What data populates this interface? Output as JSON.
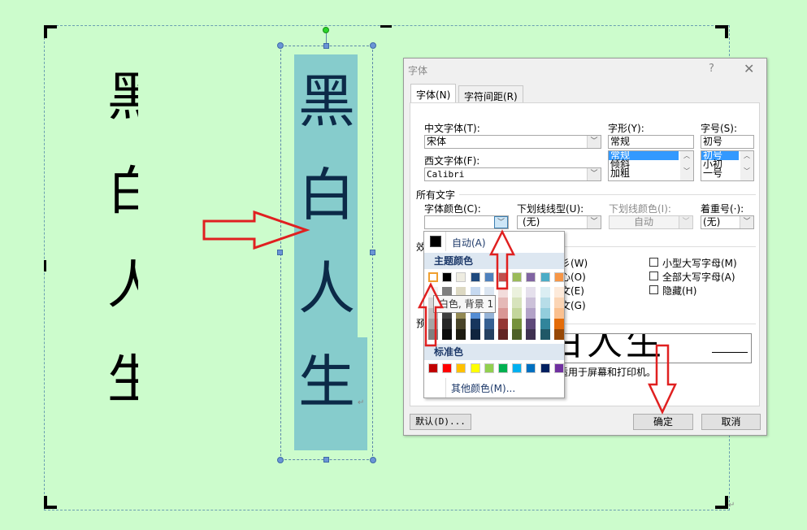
{
  "document": {
    "left_column_chars": [
      "黑",
      "白",
      "人",
      "生"
    ],
    "textbox_chars": [
      "黑",
      "白",
      "人",
      "生"
    ],
    "paragraph_mark": "↵"
  },
  "dialog": {
    "title": "字体",
    "help": "?",
    "close": "✕",
    "tabs": [
      {
        "label": "字体(N)",
        "active": true
      },
      {
        "label": "字符间距(R)",
        "active": false
      }
    ],
    "chinese_font": {
      "label": "中文字体(T):",
      "value": "宋体"
    },
    "western_font": {
      "label": "西文字体(F):",
      "value": "Calibri"
    },
    "style": {
      "label": "字形(Y):",
      "value": "常规",
      "options": [
        "常规",
        "倾斜",
        "加粗"
      ],
      "selected": "常规"
    },
    "size": {
      "label": "字号(S):",
      "value": "初号",
      "options": [
        "初号",
        "小初",
        "一号"
      ],
      "selected": "初号"
    },
    "all_text_section": "所有文字",
    "font_color": {
      "label": "字体颜色(C):",
      "value": ""
    },
    "underline_style": {
      "label": "下划线线型(U):",
      "value": "(无)"
    },
    "underline_color": {
      "label": "下划线颜色(I):",
      "value": "自动"
    },
    "emphasis": {
      "label": "着重号(·):",
      "value": "(无)"
    },
    "effects_section": "效",
    "effects_left_partial": [
      "彡(W)",
      "心(O)",
      "文(E)",
      "文(G)"
    ],
    "effects_right": [
      {
        "label": "小型大写字母(M)",
        "checked": false
      },
      {
        "label": "全部大写字母(A)",
        "checked": false
      },
      {
        "label": "隐藏(H)",
        "checked": false
      }
    ],
    "preview_section": "预",
    "preview_text": "白人生",
    "preview_note": "适用于屏幕和打印机。",
    "default_button": "默认(D)...",
    "ok_button": "确定",
    "cancel_button": "取消"
  },
  "color_palette": {
    "auto_label": "自动(A)",
    "theme_header": "主题颜色",
    "theme_colors": [
      "#ffffff",
      "#000000",
      "#eeece1",
      "#1f497d",
      "#4f81bd",
      "#c0504d",
      "#9bbb59",
      "#8064a2",
      "#4bacc6",
      "#f79646"
    ],
    "theme_shades": [
      [
        "#f2f2f2",
        "#7f7f7f",
        "#ddd9c3",
        "#c6d9f0",
        "#dbe5f1",
        "#f2dcdb",
        "#ebf1dd",
        "#e5e0ec",
        "#dbeef3",
        "#fdeada"
      ],
      [
        "#d8d8d8",
        "#595959",
        "#c4bd97",
        "#8db3e2",
        "#b8cce4",
        "#e5b9b7",
        "#d7e3bc",
        "#ccc1d9",
        "#b7dde8",
        "#fbd5b5"
      ],
      [
        "#bfbfbf",
        "#3f3f3f",
        "#938953",
        "#548dd4",
        "#95b3d7",
        "#d99694",
        "#c3d69b",
        "#b2a2c7",
        "#92cddc",
        "#fac08f"
      ],
      [
        "#a5a5a5",
        "#262626",
        "#494429",
        "#17365d",
        "#366092",
        "#953734",
        "#76923c",
        "#5f497a",
        "#31859b",
        "#e36c09"
      ],
      [
        "#7f7f7f",
        "#0c0c0c",
        "#1d1b10",
        "#0f243e",
        "#244061",
        "#632423",
        "#4f6128",
        "#3f3151",
        "#205867",
        "#974806"
      ]
    ],
    "standard_header": "标准色",
    "standard_colors": [
      "#c00000",
      "#ff0000",
      "#ffc000",
      "#ffff00",
      "#92d050",
      "#00b050",
      "#00b0f0",
      "#0070c0",
      "#002060",
      "#7030a0"
    ],
    "more_colors": "其他颜色(M)...",
    "tooltip": "白色, 背景 1"
  },
  "colors": {
    "page_bg": "#ccfccc",
    "textbox_fill": "#86cccc",
    "annotation_red": "#e02020"
  }
}
